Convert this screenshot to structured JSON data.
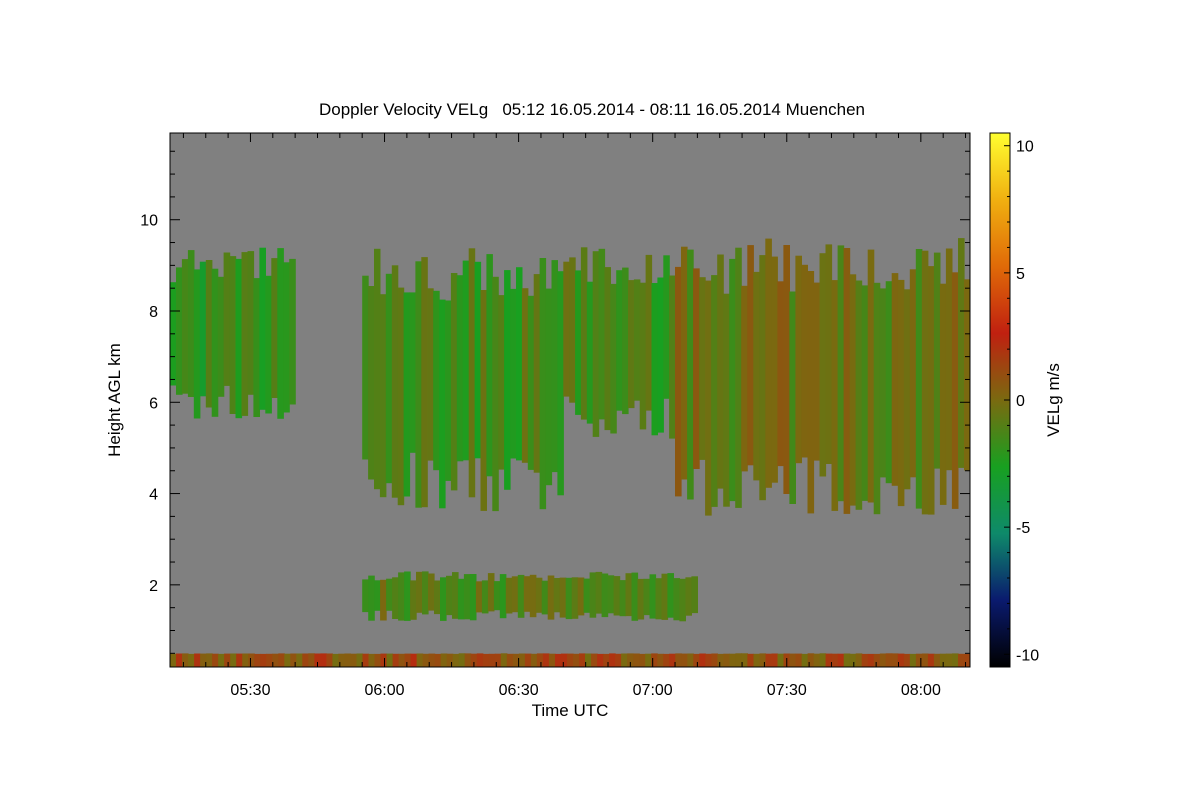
{
  "chart_data": {
    "type": "heatmap",
    "title": "Doppler Velocity VELg   05:12 16.05.2014 - 08:11 16.05.2014 Muenchen",
    "xlabel": "Time UTC",
    "ylabel": "Height AGL km",
    "xlim": [
      "05:12",
      "08:11"
    ],
    "ylim": [
      0.2,
      11.9
    ],
    "x_ticks": [
      "05:30",
      "06:00",
      "06:30",
      "07:00",
      "07:30",
      "08:00"
    ],
    "y_ticks": [
      2,
      4,
      6,
      8,
      10
    ],
    "colorbar": {
      "label": "VELg m/s",
      "range": [
        -10.5,
        10.5
      ],
      "ticks": [
        -10,
        -5,
        0,
        5,
        10
      ],
      "colors": [
        "#000000",
        "#0a1a6e",
        "#0e8a6a",
        "#18a020",
        "#7a6a10",
        "#c02010",
        "#e06a08",
        "#f0b010",
        "#ffff30"
      ]
    },
    "background_color": "#808080",
    "echo_regions": [
      {
        "name": "upper cloud 05:12-05:40",
        "t_start": "05:12",
        "t_end": "05:40",
        "base_km": 5.6,
        "top_km": 9.4,
        "velocity_ms": -2
      },
      {
        "name": "fall streaks 05:55-06:40",
        "t_start": "05:55",
        "t_end": "06:40",
        "base_km": 3.6,
        "top_km": 9.4,
        "velocity_ms": -1.5
      },
      {
        "name": "fall streaks 06:40-07:05",
        "t_start": "06:40",
        "t_end": "07:05",
        "base_km": 5.2,
        "top_km": 9.4,
        "velocity_ms": -1.5
      },
      {
        "name": "cloud 07:05-08:11",
        "t_start": "07:05",
        "t_end": "08:11",
        "base_km": 3.5,
        "top_km": 9.6,
        "velocity_ms": -0.5
      },
      {
        "name": "low layer 05:55-07:10",
        "t_start": "05:55",
        "t_end": "07:10",
        "base_km": 1.2,
        "top_km": 2.3,
        "velocity_ms": -1
      },
      {
        "name": "surface layer",
        "t_start": "05:12",
        "t_end": "08:11",
        "base_km": 0.2,
        "top_km": 0.5,
        "velocity_ms": 1
      }
    ]
  }
}
